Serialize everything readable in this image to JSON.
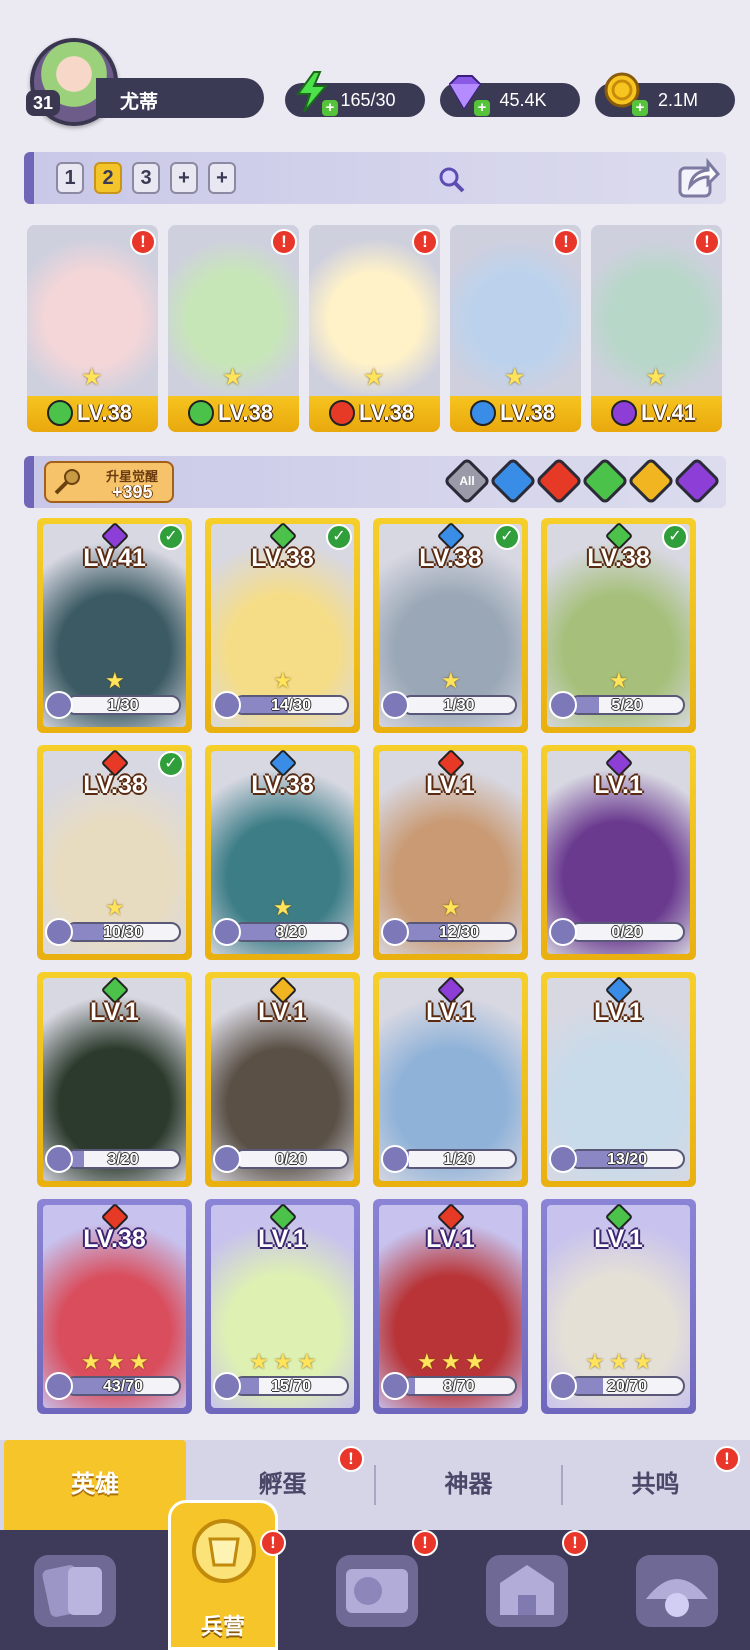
{
  "player": {
    "level": "31",
    "name": "尤蒂"
  },
  "resources": {
    "energy": "165/30",
    "gems": "45.4K",
    "gold": "2.1M"
  },
  "teams": {
    "tabs": [
      "1",
      "2",
      "3",
      "+",
      "+"
    ],
    "selected": "2"
  },
  "lineup": [
    {
      "level": "LV.38",
      "element": "wind",
      "color": "#4bc24a"
    },
    {
      "level": "LV.38",
      "element": "wind",
      "color": "#4bc24a"
    },
    {
      "level": "LV.38",
      "element": "fire",
      "color": "#e63a26"
    },
    {
      "level": "LV.38",
      "element": "water",
      "color": "#3a8de6"
    },
    {
      "level": "LV.41",
      "element": "dark",
      "color": "#8c3ed6"
    }
  ],
  "awaken": {
    "label": "升星觉醒",
    "count": "+395"
  },
  "filters": {
    "all": "All",
    "elements": [
      "water",
      "fire",
      "wind",
      "light",
      "dark"
    ]
  },
  "heroes": [
    {
      "level": "LV.41",
      "element": "dark",
      "progress": "1/30",
      "fill": 0.03,
      "check": true
    },
    {
      "level": "LV.38",
      "element": "wind",
      "progress": "14/30",
      "fill": 0.47,
      "check": true
    },
    {
      "level": "LV.38",
      "element": "water",
      "progress": "1/30",
      "fill": 0.03,
      "check": true
    },
    {
      "level": "LV.38",
      "element": "wind",
      "progress": "5/20",
      "fill": 0.25,
      "check": true
    },
    {
      "level": "LV.38",
      "element": "fire",
      "progress": "10/30",
      "fill": 0.33,
      "check": true
    },
    {
      "level": "LV.38",
      "element": "water",
      "progress": "8/20",
      "fill": 0.4,
      "check": false
    },
    {
      "level": "LV.1",
      "element": "fire",
      "progress": "12/30",
      "fill": 0.4,
      "check": false
    },
    {
      "level": "LV.1",
      "element": "dark",
      "progress": "0/20",
      "fill": 0,
      "check": false
    },
    {
      "level": "LV.1",
      "element": "wind",
      "progress": "3/20",
      "fill": 0.15,
      "check": false
    },
    {
      "level": "LV.1",
      "element": "light",
      "progress": "0/20",
      "fill": 0,
      "check": false
    },
    {
      "level": "LV.1",
      "element": "dark",
      "progress": "1/20",
      "fill": 0.05,
      "check": false
    },
    {
      "level": "LV.1",
      "element": "water",
      "progress": "13/20",
      "fill": 0.65,
      "check": false
    },
    {
      "level": "LV.38",
      "element": "fire",
      "progress": "43/70",
      "fill": 0.61,
      "check": false
    },
    {
      "level": "LV.1",
      "element": "wind",
      "progress": "15/70",
      "fill": 0.21,
      "check": false
    },
    {
      "level": "LV.1",
      "element": "fire",
      "progress": "8/70",
      "fill": 0.11,
      "check": false
    },
    {
      "level": "LV.1",
      "element": "wind",
      "progress": "20/70",
      "fill": 0.29,
      "check": false
    }
  ],
  "tabs": [
    {
      "label": "英雄",
      "active": true
    },
    {
      "label": "孵蛋",
      "alert": true
    },
    {
      "label": "神器"
    },
    {
      "label": "共鸣",
      "alert": true
    }
  ],
  "nav": {
    "active_label": "兵营"
  },
  "colors": {
    "wind": "#4bc24a",
    "fire": "#e63a26",
    "water": "#3a8de6",
    "dark": "#8c3ed6",
    "light": "#f0b521",
    "gold": "#f6c52a",
    "purple": "#8b84d6"
  }
}
